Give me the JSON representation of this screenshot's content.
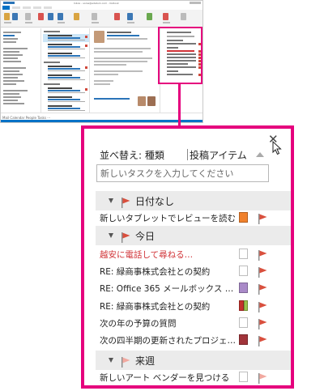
{
  "outlook": {
    "window_title": "Inbox - sonia@adatum.com - Outlook",
    "nav_label": "Mail   Calendar   People   Tasks   ···"
  },
  "todo_panel": {
    "sort_label": "並べ替え: 種類",
    "sort_value": "投稿アイテム",
    "new_task_placeholder": "新しいタスクを入力してください",
    "groups": [
      {
        "label": "日付なし",
        "tasks": [
          {
            "title": "新しいタブレットでレビューを読む",
            "category": "orange",
            "overdue": false
          }
        ]
      },
      {
        "label": "今日",
        "tasks": [
          {
            "title": "越安に電話して尋ねる…",
            "category": "none",
            "overdue": true
          },
          {
            "title": "RE: 緑商事株式会社との契約",
            "category": "none",
            "overdue": false
          },
          {
            "title": "RE: Office 365 メールボックス スペ…",
            "category": "purple",
            "overdue": false
          },
          {
            "title": "RE: 緑商事株式会社との契約",
            "category": "red-green",
            "overdue": false
          },
          {
            "title": "次の年の予算の質問",
            "category": "none",
            "overdue": false
          },
          {
            "title": "次の四半期の更新されたプロジェクト…",
            "category": "darkred",
            "overdue": false
          }
        ]
      },
      {
        "label": "来週",
        "tasks": [
          {
            "title": "新しいアート ベンダーを見つける",
            "category": "none",
            "overdue": false
          }
        ]
      }
    ],
    "colors": {
      "highlight": "#e5007d",
      "flag": "#d94f3d",
      "flag_light": "#f2a9a0",
      "overdue_text": "#d13438",
      "orange": "#f0812c",
      "purple": "#a98ac8",
      "red": "#c4312c",
      "green": "#9bc24a",
      "darkred": "#a1343a"
    }
  }
}
